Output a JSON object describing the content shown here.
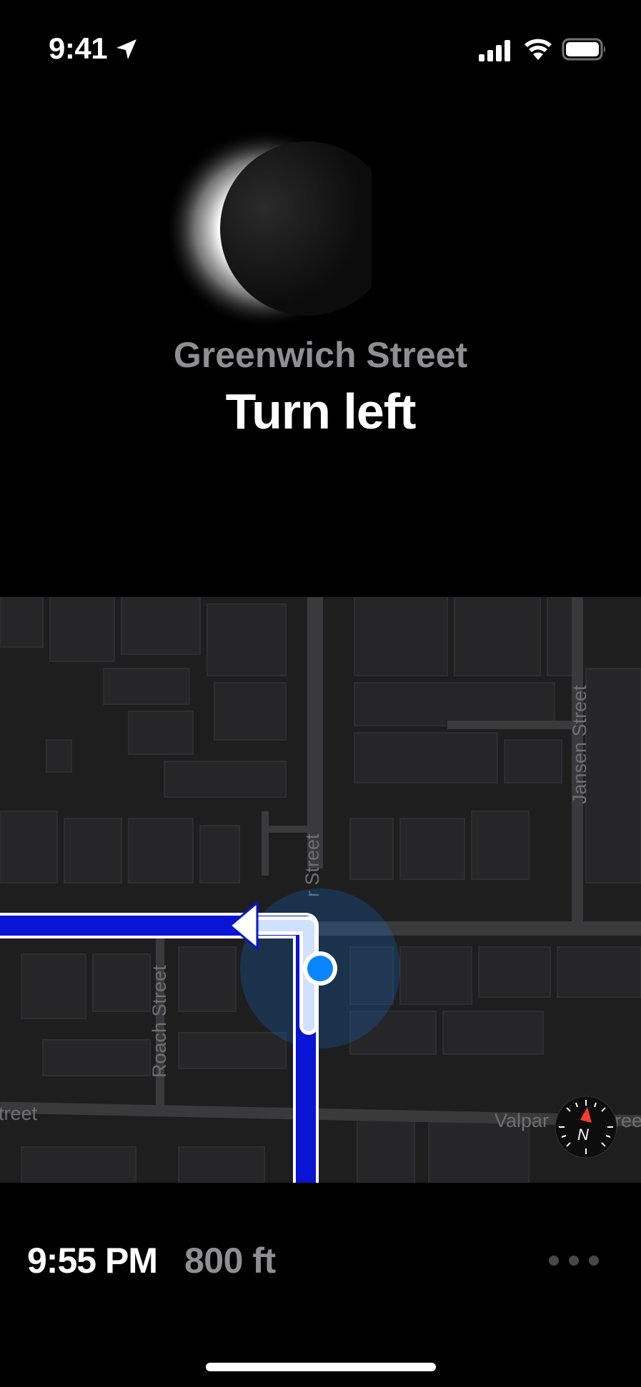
{
  "status_bar": {
    "time": "9:41",
    "icons": [
      "location-arrow-icon",
      "cellular-signal-icon",
      "wifi-icon",
      "battery-icon"
    ]
  },
  "guidance": {
    "street": "Greenwich Street",
    "instruction": "Turn left",
    "icon": "eclipse-icon"
  },
  "map": {
    "labels": {
      "jansen": "Jansen Street",
      "roach": "Roach Street",
      "current": "r Street",
      "left_street": "treet",
      "valparaiso_left": "Valpar",
      "valparaiso_right": "ree"
    },
    "compass_letter": "N",
    "colors": {
      "route": "#0a14d4",
      "user_location": "#0a84ff",
      "background": "#1e1e1f",
      "compass_needle": "#ff3b30"
    }
  },
  "trip": {
    "arrival_time": "9:55 PM",
    "distance": "800 ft",
    "more_icon": "more-options-icon"
  }
}
